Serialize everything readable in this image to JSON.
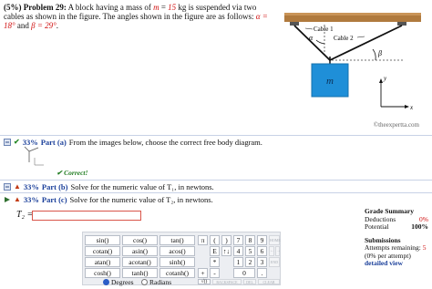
{
  "problem": {
    "label": "(5%)  Problem 29:",
    "text_1": "A block having a mass of",
    "mass_var": "m",
    "mass_eq": " = ",
    "mass_value": "15",
    "mass_unit": " kg is suspended via two cables as shown in the figure. The angles shown in the figure are as follows: ",
    "alpha_text": "α = 18°",
    "and_text": " and ",
    "beta_text": "β = 29°",
    "end": "."
  },
  "figure": {
    "cable1_label": "Cable 1",
    "cable2_label": "Cable 2",
    "alpha_label": "α",
    "beta_label": "β",
    "block_label": "m",
    "y_label": "y",
    "x_label": "x",
    "credit": "©theexpertta.com"
  },
  "parts": [
    {
      "percent": "33%",
      "label": "Part (a)",
      "text": "From the images below, choose the correct free body diagram."
    },
    {
      "percent": "33%",
      "label": "Part (b)",
      "text": "Solve for the numeric value of T₁, in newtons."
    },
    {
      "percent": "33%",
      "label": "Part (c)",
      "text": "Solve for the numeric value of T₂, in newtons."
    }
  ],
  "part_a_status": "✔ Correct!",
  "answer": {
    "label": "T₂ =",
    "value": ""
  },
  "keypad": {
    "fn_keys": [
      "sin()",
      "cos()",
      "tan()",
      "cotan()",
      "asin()",
      "acos()",
      "atan()",
      "acotan()",
      "sinh()",
      "cosh()",
      "tanh()",
      "cotanh()"
    ],
    "sym_keys": [
      "π",
      "(",
      ")",
      "E",
      "↑↓",
      "*",
      "+",
      "-",
      "√()"
    ],
    "num_keys": [
      "7",
      "8",
      "9",
      "4",
      "5",
      "6",
      "1",
      "2",
      "3",
      "0",
      "."
    ],
    "util_keys": [
      "HOME",
      "←",
      "→",
      "END",
      "BACKSPACE",
      "DEL",
      "CLEAR"
    ],
    "degrees": "Degrees",
    "radians": "Radians"
  },
  "grade": {
    "title": "Grade Summary",
    "deductions_label": "Deductions",
    "deductions_value": "0%",
    "potential_label": "Potential",
    "potential_value": "100%",
    "submissions_title": "Submissions",
    "attempts_label": "Attempts remaining:",
    "attempts_value": "5",
    "per_attempt": "(0% per attempt)",
    "detailed": "detailed view"
  }
}
